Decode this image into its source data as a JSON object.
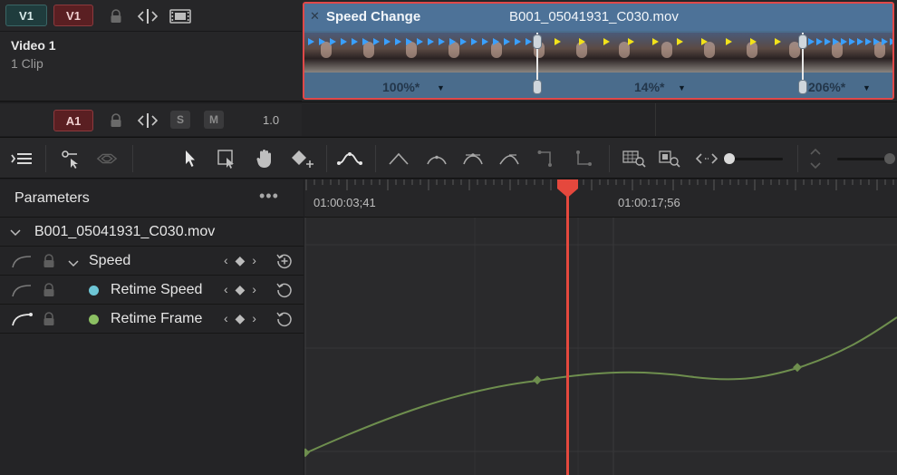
{
  "video_track": {
    "dest_label": "V1",
    "src_label": "V1",
    "name": "Video 1",
    "clip_count": "1 Clip"
  },
  "audio_track": {
    "label": "A1",
    "solo": "S",
    "mute": "M",
    "volume": "1.0"
  },
  "clip": {
    "effect_title": "Speed Change",
    "filename": "B001_05041931_C030.mov",
    "close_glyph": "✕",
    "speeds": [
      {
        "label": "100%*"
      },
      {
        "label": "14%*"
      },
      {
        "label": "206%*"
      }
    ]
  },
  "parameters": {
    "title": "Parameters",
    "more": "•••",
    "clip_name": "B001_05041931_C030.mov",
    "rows": [
      {
        "label": "Speed",
        "kind": "group"
      },
      {
        "label": "Retime Speed",
        "dot_color": "#6ec6d6"
      },
      {
        "label": "Retime Frame",
        "dot_color": "#8cc063"
      }
    ],
    "keyframe_nav": "‹ ◆ ›"
  },
  "graph": {
    "timecodes": [
      "01:00:03;41",
      "01:00:17;56"
    ],
    "curve_color": "#6e8e4e",
    "playhead_color": "#e5483d"
  },
  "colors": {
    "accent_red": "#e04848",
    "clip_blue": "#4d7298",
    "speed_handle": "#e8e8e8"
  }
}
